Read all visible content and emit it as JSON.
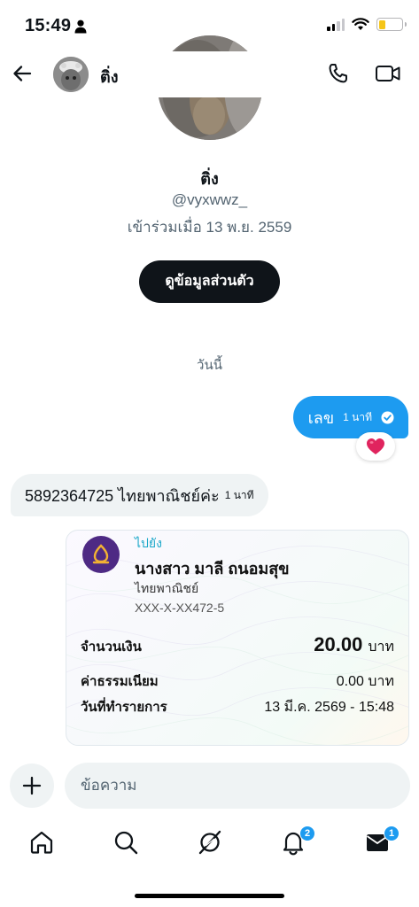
{
  "status_bar": {
    "time": "15:49"
  },
  "header": {
    "name": "ติ่ง"
  },
  "profile": {
    "name": "ติ่ง",
    "handle": "@vyxwwz_",
    "joined": "เข้าร่วมเมื่อ 13 พ.ย. 2559",
    "view_profile_label": "ดูข้อมูลส่วนตัว"
  },
  "conversation": {
    "date_label": "วันนี้",
    "messages": [
      {
        "direction": "outgoing",
        "text": "เลข",
        "time": "1 นาที",
        "status": "read",
        "reaction": "❤️"
      },
      {
        "direction": "incoming",
        "text": "5892364725 ไทยพาณิชย์ค่ะ",
        "time": "1 นาที"
      }
    ]
  },
  "transfer_slip": {
    "to_label": "ไปยัง",
    "recipient": "นางสาว มาลี ถนอมสุข",
    "bank": "ไทยพาณิชย์",
    "account": "XXX-X-XX472-5",
    "amount_label": "จำนวนเงิน",
    "amount": "20.00",
    "amount_unit": "บาท",
    "fee_label": "ค่าธรรมเนียม",
    "fee": "0.00 บาท",
    "date_label": "วันที่ทำรายการ",
    "date": "13 มี.ค. 2569 - 15:48"
  },
  "composer": {
    "placeholder": "ข้อความ"
  },
  "bottom_nav": {
    "items": [
      {
        "icon": "home-icon"
      },
      {
        "icon": "search-icon"
      },
      {
        "icon": "grok-icon"
      },
      {
        "icon": "notifications-icon",
        "badge": "2"
      },
      {
        "icon": "messages-icon",
        "badge": "1"
      }
    ]
  },
  "colors": {
    "accent": "#1d9bf0",
    "text": "#0f1419",
    "muted": "#536471",
    "bubble_in": "#eff3f4",
    "bank_logo": "#4e2a84"
  }
}
